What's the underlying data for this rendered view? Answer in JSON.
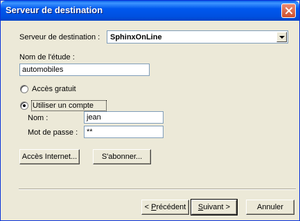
{
  "window": {
    "title": "Serveur de destination"
  },
  "server": {
    "label": "Serveur de destination :",
    "selected": "SphinxOnLine"
  },
  "study": {
    "label": "Nom de l'étude :",
    "value": "automobiles"
  },
  "access": {
    "free_label": "Accès gratuit",
    "account_label": "Utiliser un compte",
    "selected": "account"
  },
  "account": {
    "name_label": "Nom :",
    "name_value": "jean",
    "password_label": "Mot de passe :",
    "password_value": "**"
  },
  "buttons": {
    "internet": "Accès Internet...",
    "subscribe": "S'abonner...",
    "previous_prefix": "< ",
    "previous_mnemonic": "P",
    "previous_rest": "récédent",
    "next_mnemonic": "S",
    "next_rest": "uivant >",
    "cancel": "Annuler"
  }
}
